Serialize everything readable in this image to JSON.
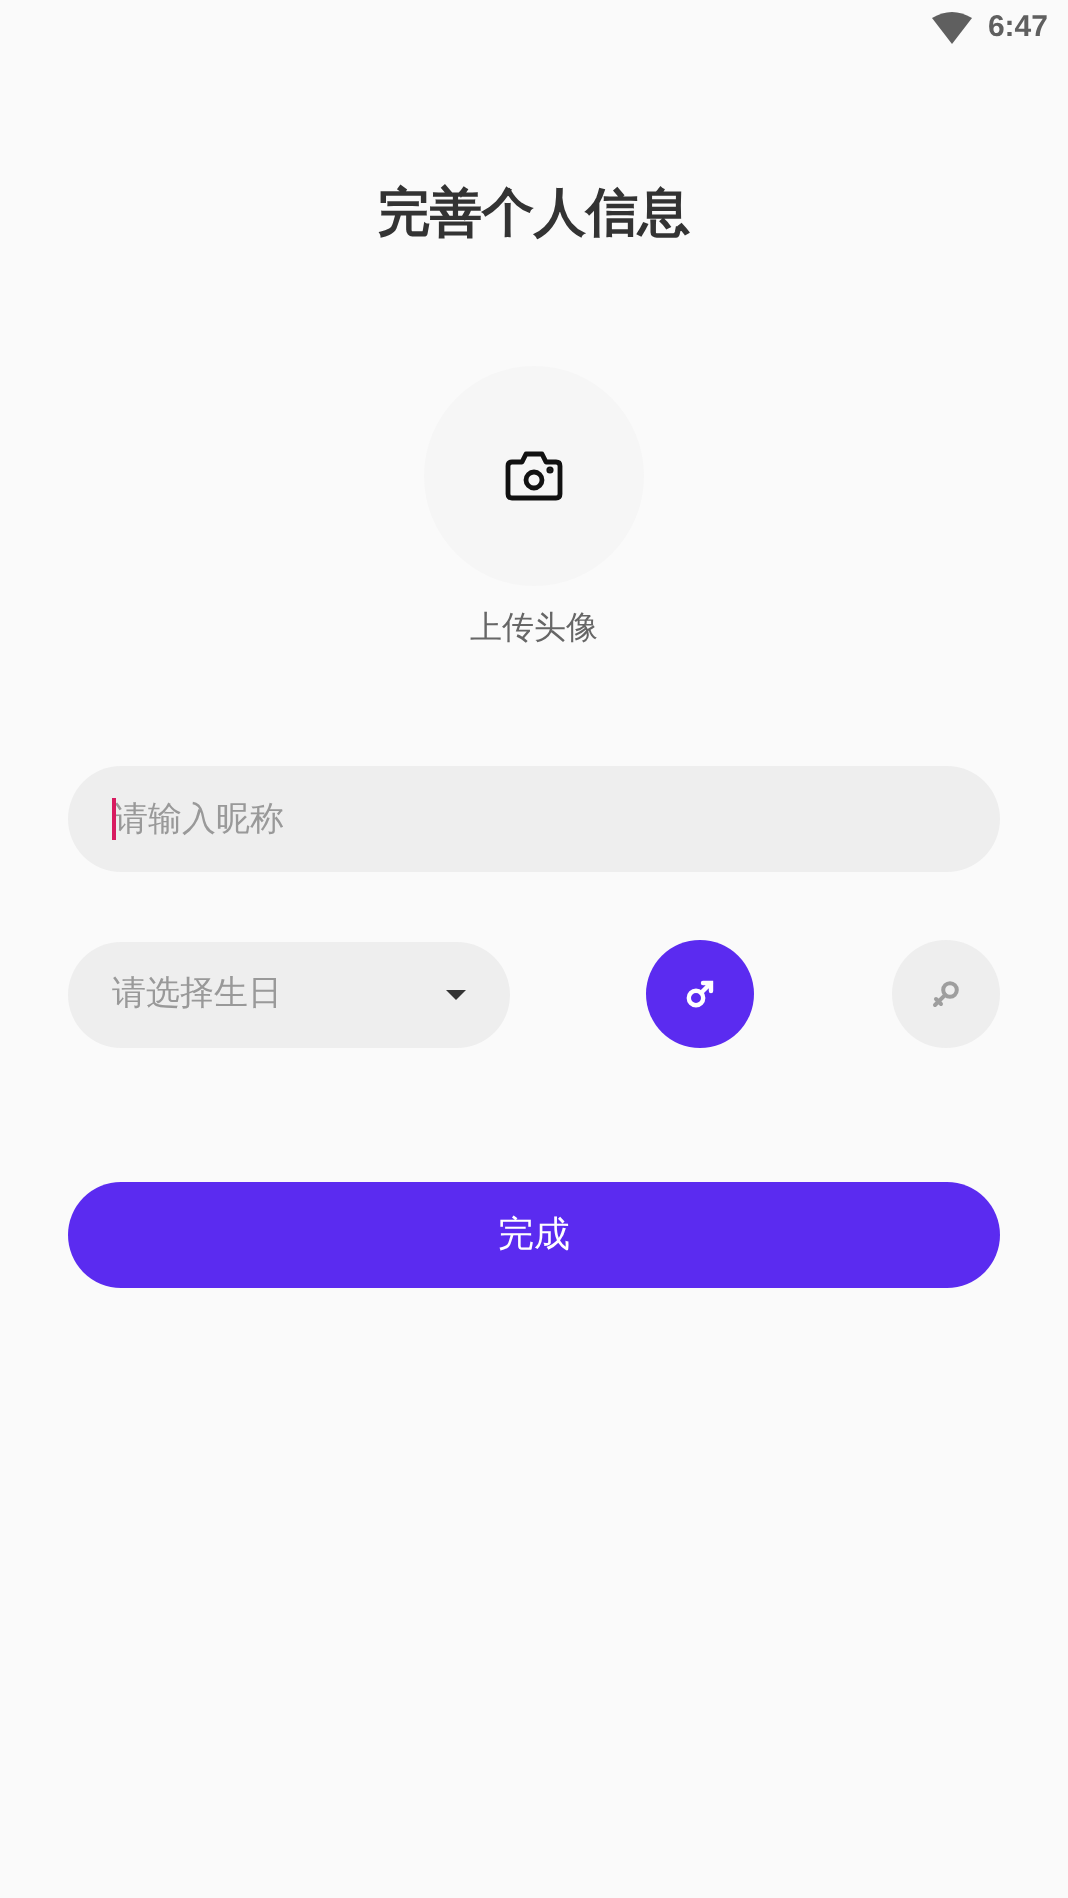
{
  "status_bar": {
    "time": "6:47"
  },
  "title": "完善个人信息",
  "avatar": {
    "label": "上传头像"
  },
  "nickname": {
    "placeholder": "请输入昵称",
    "focused": true
  },
  "birthday": {
    "placeholder": "请选择生日"
  },
  "gender": [
    {
      "kind": "male",
      "selected": true
    },
    {
      "kind": "female",
      "selected": false
    }
  ],
  "submit": "完成"
}
